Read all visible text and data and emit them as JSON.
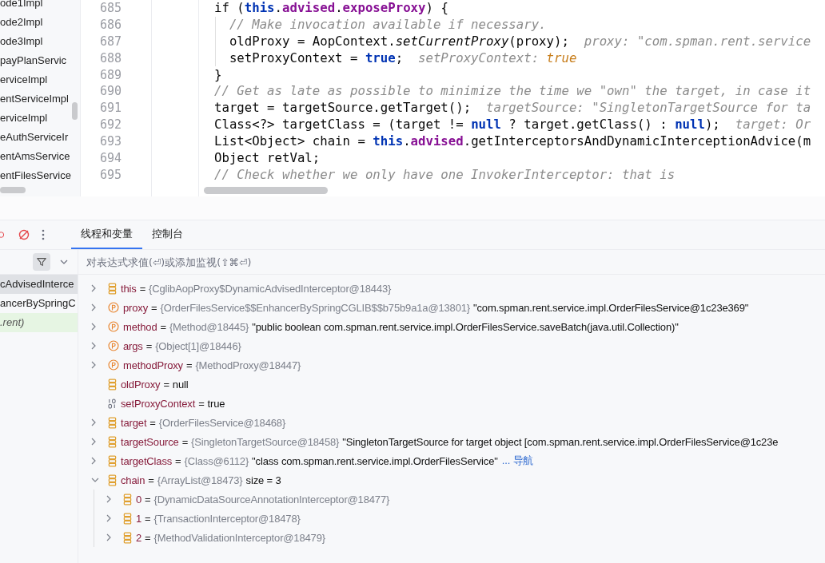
{
  "project_tree": {
    "items": [
      "ode1Impl",
      "ode2Impl",
      "ode3Impl",
      "payPlanServic",
      "erviceImpl",
      "entServiceImpl",
      "erviceImpl",
      "eAuthServiceIr",
      "entAmsService",
      "entFilesService"
    ]
  },
  "editor": {
    "lines": [
      {
        "number": "685",
        "segments": [
          {
            "text": "if (",
            "kind": "plain"
          },
          {
            "text": "this",
            "kind": "keyword"
          },
          {
            "text": ".",
            "kind": "plain"
          },
          {
            "text": "advised",
            "kind": "field"
          },
          {
            "text": ".",
            "kind": "plain"
          },
          {
            "text": "exposeProxy",
            "kind": "field"
          },
          {
            "text": ") {",
            "kind": "plain"
          }
        ],
        "children": [
          {
            "number": "686",
            "segments": [
              {
                "text": "// Make invocation available if necessary.",
                "kind": "comment"
              }
            ]
          },
          {
            "number": "687",
            "segments": [
              {
                "text": "oldProxy = AopContext.",
                "kind": "plain"
              },
              {
                "text": "setCurrentProxy",
                "kind": "static_call"
              },
              {
                "text": "(proxy);",
                "kind": "plain"
              },
              {
                "text": "proxy: \"com.spman.rent.service",
                "kind": "hint"
              }
            ]
          },
          {
            "number": "688",
            "segments": [
              {
                "text": "setProxyContext = ",
                "kind": "plain"
              },
              {
                "text": "true",
                "kind": "keyword"
              },
              {
                "text": ";",
                "kind": "plain"
              },
              {
                "text": "setProxyContext: ",
                "kind": "hint"
              },
              {
                "text": "true",
                "kind": "hint_value"
              }
            ]
          }
        ]
      },
      {
        "number": "689",
        "segments": [
          {
            "text": "}",
            "kind": "plain"
          }
        ]
      },
      {
        "number": "690",
        "segments": [
          {
            "text": "// Get as late as possible to minimize the time we \"own\" the target, in case it",
            "kind": "comment"
          }
        ]
      },
      {
        "number": "691",
        "segments": [
          {
            "text": "target = targetSource.getTarget();",
            "kind": "plain"
          },
          {
            "text": "targetSource: \"SingletonTargetSource for ta",
            "kind": "hint"
          }
        ]
      },
      {
        "number": "692",
        "segments": [
          {
            "text": "Class<?> targetClass = (target != ",
            "kind": "plain"
          },
          {
            "text": "null",
            "kind": "keyword"
          },
          {
            "text": " ? target.getClass() : ",
            "kind": "plain"
          },
          {
            "text": "null",
            "kind": "keyword"
          },
          {
            "text": ");",
            "kind": "plain"
          },
          {
            "text": "target: Or",
            "kind": "hint"
          }
        ]
      },
      {
        "number": "693",
        "segments": [
          {
            "text": "List<Object> chain = ",
            "kind": "plain"
          },
          {
            "text": "this",
            "kind": "keyword"
          },
          {
            "text": ".",
            "kind": "plain"
          },
          {
            "text": "advised",
            "kind": "field"
          },
          {
            "text": ".getInterceptorsAndDynamicInterceptionAdvice(m",
            "kind": "plain"
          }
        ]
      },
      {
        "number": "694",
        "segments": [
          {
            "text": "Object retVal;",
            "kind": "plain"
          }
        ]
      },
      {
        "number": "695",
        "segments": [
          {
            "text": "// Check whether we only have one InvokerInterceptor: that is",
            "kind": "comment"
          }
        ]
      }
    ]
  },
  "debugger": {
    "tabs": [
      {
        "label": "线程和变量",
        "selected": true
      },
      {
        "label": "控制台",
        "selected": false
      }
    ],
    "eval_field": {
      "placeholder": "对表达式求值(⏎)或添加监视(⇧⌘⏎)"
    },
    "frames": [
      {
        "label": "cAdvisedInterce",
        "selected": true,
        "highlighted": false
      },
      {
        "label": "ancerBySpringC",
        "selected": false,
        "highlighted": false
      },
      {
        "label": ".rent)",
        "selected": false,
        "highlighted": true
      }
    ],
    "variables": [
      {
        "kind": "field",
        "expanded": false,
        "name": "this",
        "operator": "=",
        "type_text": "{CglibAopProxy$DynamicAdvisedInterceptor@18443}"
      },
      {
        "kind": "param",
        "expanded": false,
        "name": "proxy",
        "operator": "=",
        "type_text": "{OrderFilesService$$EnhancerBySpringCGLIB$$b75b9a1a@13801}",
        "value_text": "\"com.spman.rent.service.impl.OrderFilesService@1c23e369\""
      },
      {
        "kind": "param",
        "expanded": false,
        "name": "method",
        "operator": "=",
        "type_text": "{Method@18445}",
        "value_text": "\"public boolean com.spman.rent.service.impl.OrderFilesService.saveBatch(java.util.Collection)\""
      },
      {
        "kind": "param",
        "expanded": false,
        "name": "args",
        "operator": "=",
        "type_text": "{Object[1]@18446}"
      },
      {
        "kind": "param",
        "expanded": false,
        "name": "methodProxy",
        "operator": "=",
        "type_text": "{MethodProxy@18447}"
      },
      {
        "kind": "field",
        "name": "oldProxy",
        "operator": "=",
        "value_text": "null"
      },
      {
        "kind": "boolean",
        "name": "setProxyContext",
        "operator": "=",
        "value_text": "true"
      },
      {
        "kind": "field",
        "expanded": false,
        "name": "target",
        "operator": "=",
        "type_text": "{OrderFilesService@18468}"
      },
      {
        "kind": "field",
        "expanded": false,
        "name": "targetSource",
        "operator": "=",
        "type_text": "{SingletonTargetSource@18458}",
        "value_text": "\"SingletonTargetSource for target object [com.spman.rent.service.impl.OrderFilesService@1c23e"
      },
      {
        "kind": "field",
        "expanded": false,
        "name": "targetClass",
        "operator": "=",
        "type_text": "{Class@6112}",
        "value_text": "\"class com.spman.rent.service.impl.OrderFilesService\"",
        "link": "... 导航"
      },
      {
        "kind": "field",
        "expanded": true,
        "name": "chain",
        "operator": "=",
        "type_text": "{ArrayList@18473}",
        "value_text": "size = 3",
        "children": [
          {
            "kind": "field",
            "expanded": false,
            "name": "0",
            "operator": "=",
            "type_text": "{DynamicDataSourceAnnotationInterceptor@18477}"
          },
          {
            "kind": "field",
            "expanded": false,
            "name": "1",
            "operator": "=",
            "type_text": "{TransactionInterceptor@18478}"
          },
          {
            "kind": "field",
            "expanded": false,
            "name": "2",
            "operator": "=",
            "type_text": "{MethodValidationInterceptor@18479}"
          }
        ]
      }
    ]
  }
}
